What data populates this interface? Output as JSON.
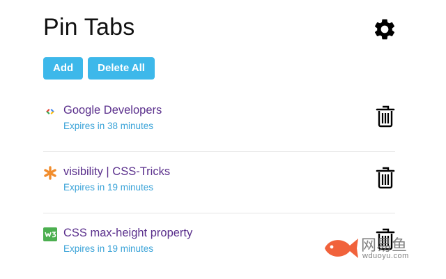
{
  "header": {
    "title": "Pin Tabs",
    "settings_icon": "gear-icon"
  },
  "toolbar": {
    "add_label": "Add",
    "delete_all_label": "Delete All"
  },
  "tabs": [
    {
      "title": "Google Developers",
      "expires": "Expires in 38 minutes",
      "favicon": "google-developers-icon"
    },
    {
      "title": "visibility | CSS-Tricks",
      "expires": "Expires in 19 minutes",
      "favicon": "css-tricks-icon"
    },
    {
      "title": "CSS max-height property",
      "expires": "Expires in 19 minutes",
      "favicon": "w3schools-icon"
    }
  ],
  "watermark": {
    "text_cn": "网易鱼",
    "text_en": "wduoyu.com"
  },
  "colors": {
    "button_bg": "#3db8ea",
    "link": "#5a2f8c",
    "subtext": "#3aa3d8"
  }
}
